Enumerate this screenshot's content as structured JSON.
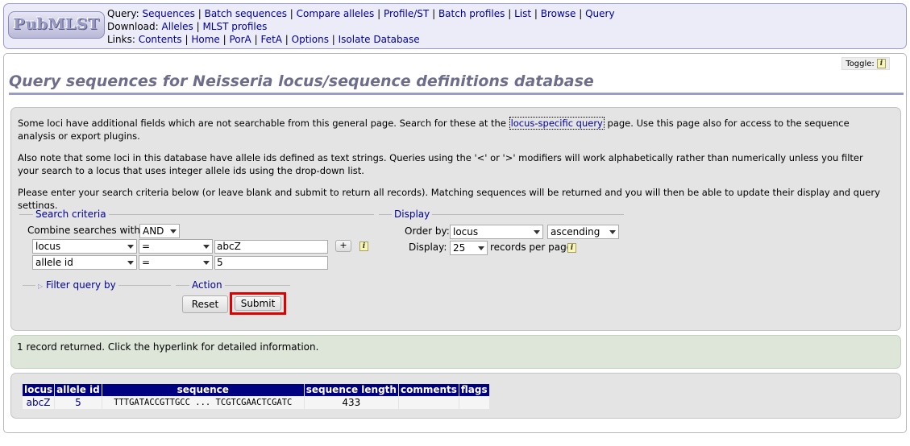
{
  "header": {
    "logo_text": "PubMLST",
    "query_label": "Query:",
    "query_links": [
      "Sequences",
      "Batch sequences",
      "Compare alleles",
      "Profile/ST",
      "Batch profiles",
      "List",
      "Browse",
      "Query"
    ],
    "download_label": "Download:",
    "download_links": [
      "Alleles",
      "MLST profiles"
    ],
    "links_label": "Links:",
    "links_links": [
      "Contents",
      "Home",
      "PorA",
      "FetA",
      "Options",
      "Isolate Database"
    ]
  },
  "toggle": {
    "label": "Toggle:",
    "icon": "info-icon"
  },
  "page_title": "Query sequences for Neisseria locus/sequence definitions database",
  "intro": {
    "p1_before": "Some loci have additional fields which are not searchable from this general page. Search for these at the ",
    "p1_link": "locus-specific query",
    "p1_after": " page. Use this page also for access to the sequence analysis or export plugins.",
    "p2": "Also note that some loci in this database have allele ids defined as text strings. Queries using the '<' or '>' modifiers will work alphabetically rather than numerically unless you filter your search to a locus that uses integer allele ids using the drop-down list.",
    "p3": "Please enter your search criteria below (or leave blank and submit to return all records). Matching sequences will be returned and you will then be able to update their display and query settings."
  },
  "search_criteria": {
    "legend": "Search criteria",
    "combine_label": "Combine searches with:",
    "combine_value": "AND",
    "rows": [
      {
        "field": "locus",
        "operator": "=",
        "value": "abcZ"
      },
      {
        "field": "allele id",
        "operator": "=",
        "value": "5"
      }
    ],
    "add_button": "+"
  },
  "display": {
    "legend": "Display",
    "order_label": "Order by:",
    "order_value": "locus",
    "direction_value": "ascending",
    "display_label": "Display:",
    "display_value": "25",
    "per_page_label": "records per page"
  },
  "filter": {
    "legend": "Filter query by"
  },
  "action": {
    "legend": "Action",
    "reset_label": "Reset",
    "submit_label": "Submit"
  },
  "result_message": "1 record returned. Click the hyperlink for detailed information.",
  "results_table": {
    "headers": [
      "locus",
      "allele id",
      "sequence",
      "sequence length",
      "comments",
      "flags"
    ],
    "rows": [
      {
        "locus": "abcZ",
        "allele_id": "5",
        "sequence": "TTTGATACCGTTGCC ... TCGTCGAACTCGATC",
        "length": "433",
        "comments": "",
        "flags": ""
      }
    ]
  },
  "colors": {
    "header_bg": "#ecebf8",
    "link": "#000099",
    "table_header": "#000080",
    "submit_highlight": "#e00000"
  }
}
